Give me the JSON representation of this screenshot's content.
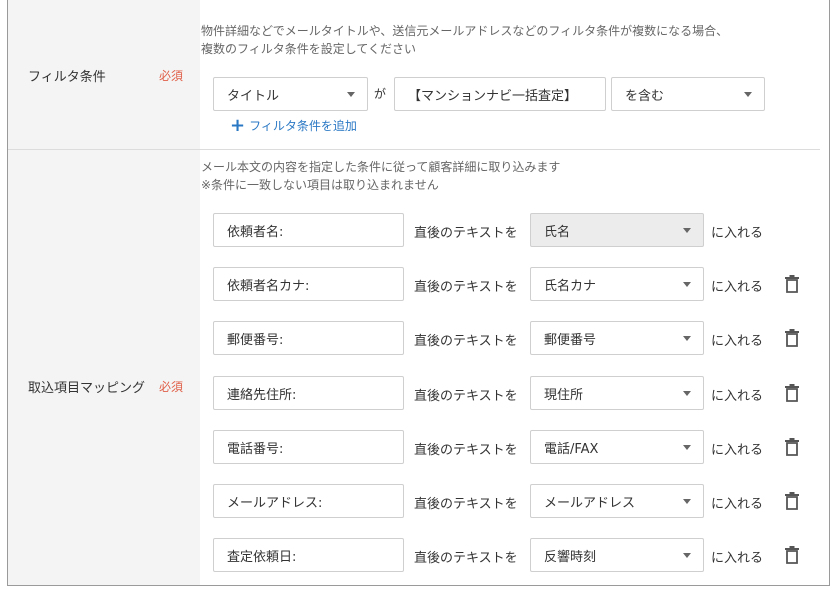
{
  "filter": {
    "label": "フィルタ条件",
    "required": "必須",
    "hint_line1": "物件詳細などでメールタイトルや、送信元メールアドレスなどのフィルタ条件が複数になる場合、",
    "hint_line2": "複数のフィルタ条件を設定してください",
    "field_select": "タイトル",
    "connector": "が",
    "value": "【マンションナビ一括査定】",
    "condition_select": "を含む",
    "add_label": "フィルタ条件を追加"
  },
  "mapping": {
    "label": "取込項目マッピング",
    "required": "必須",
    "hint_line1": "メール本文の内容を指定した条件に従って顧客詳細に取り込みます",
    "hint_line2": "※条件に一致しない項目は取り込まれません",
    "after_text_label": "直後のテキストを",
    "put_in_label": "に入れる",
    "rows": [
      {
        "key": "依頼者名:",
        "target": "氏名",
        "deletable": false
      },
      {
        "key": "依頼者名カナ:",
        "target": "氏名カナ",
        "deletable": true
      },
      {
        "key": "郵便番号:",
        "target": "郵便番号",
        "deletable": true
      },
      {
        "key": "連絡先住所:",
        "target": "現住所",
        "deletable": true
      },
      {
        "key": "電話番号:",
        "target": "電話/FAX",
        "deletable": true
      },
      {
        "key": "メールアドレス:",
        "target": "メールアドレス",
        "deletable": true
      },
      {
        "key": "査定依頼日:",
        "target": "反響時刻",
        "deletable": true
      }
    ]
  },
  "colors": {
    "required": "#e0604a",
    "link": "#2a78c4",
    "label_bg": "#f4f4f4"
  },
  "icons": {
    "add": "plus-icon",
    "delete": "trash-icon",
    "dropdown": "caret-down-icon"
  }
}
